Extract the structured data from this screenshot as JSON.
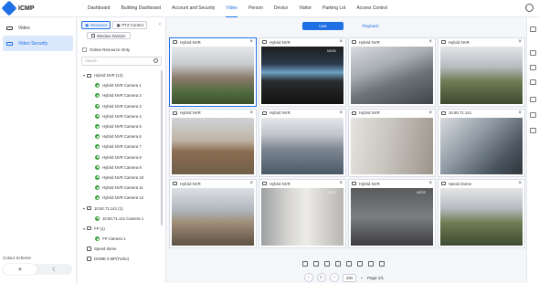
{
  "app": {
    "brand": "ICMP"
  },
  "menu": [
    "Dashboard",
    "Building Dashboard",
    "Account and Security",
    "Video",
    "Person",
    "Device",
    "Visitor",
    "Parking Lot",
    "Access Control"
  ],
  "menu_active": "Video",
  "leftnav": [
    {
      "label": "Video",
      "selected": false
    },
    {
      "label": "Video Security",
      "selected": true
    }
  ],
  "colour_scheme": {
    "label": "Colour Scheme",
    "options": [
      "☀",
      "☾"
    ],
    "active": 0
  },
  "resource": {
    "tabs": [
      {
        "label": "Resource",
        "on": true
      },
      {
        "label": "PTZ Control",
        "on": false
      }
    ],
    "window_division": "Window Division",
    "online_only": "Online Resource Only",
    "search_placeholder": "Search",
    "tree": [
      {
        "label": "Hybrid NVR (12)",
        "type": "nvr",
        "indent": 0,
        "arrow": "▾"
      },
      {
        "label": "Hybrid NVR Camera 1",
        "type": "cam",
        "indent": 1
      },
      {
        "label": "Hybrid NVR Camera 2",
        "type": "cam",
        "indent": 1
      },
      {
        "label": "Hybrid NVR Camera 3",
        "type": "cam",
        "indent": 1
      },
      {
        "label": "Hybrid NVR Camera 4",
        "type": "cam",
        "indent": 1
      },
      {
        "label": "Hybrid NVR Camera 5",
        "type": "cam",
        "indent": 1
      },
      {
        "label": "Hybrid NVR Camera 6",
        "type": "cam",
        "indent": 1
      },
      {
        "label": "Hybrid NVR Camera 7",
        "type": "cam",
        "indent": 1
      },
      {
        "label": "Hybrid NVR Camera 8",
        "type": "cam",
        "indent": 1
      },
      {
        "label": "Hybrid NVR Camera 9",
        "type": "cam",
        "indent": 1
      },
      {
        "label": "Hybrid NVR Camera 10",
        "type": "cam",
        "indent": 1
      },
      {
        "label": "Hybrid NVR Camera 11",
        "type": "cam",
        "indent": 1
      },
      {
        "label": "Hybrid NVR Camera 12",
        "type": "cam",
        "indent": 1
      },
      {
        "label": "10.50.71.141 (1)",
        "type": "nvr",
        "indent": 0,
        "arrow": "▾"
      },
      {
        "label": "10.50.71.141 Camera 1",
        "type": "cam",
        "indent": 1
      },
      {
        "label": "FP (1)",
        "type": "nvr",
        "indent": 0,
        "arrow": "▾"
      },
      {
        "label": "FP Camera 1",
        "type": "cam",
        "indent": 1
      },
      {
        "label": "Speed dome",
        "type": "dome",
        "indent": 0
      },
      {
        "label": "DOME 5 MP(Turbo)",
        "type": "dome",
        "indent": 0
      }
    ]
  },
  "view": {
    "live": "Live",
    "playback": "Playback"
  },
  "tiles": [
    {
      "title": "Hybrid NVR",
      "scene": "v-sky",
      "msse": "",
      "sel": true
    },
    {
      "title": "Hybrid NVR",
      "scene": "v-dark",
      "msse": "MSSE",
      "sel": false
    },
    {
      "title": "Hybrid NVR",
      "scene": "v-street",
      "msse": "",
      "sel": false
    },
    {
      "title": "Hybrid NVR",
      "scene": "v-trees",
      "msse": "",
      "sel": false
    },
    {
      "title": "Hybrid NVR",
      "scene": "v-roof",
      "msse": "",
      "sel": false
    },
    {
      "title": "Hybrid NVR",
      "scene": "v-river",
      "msse": "",
      "sel": false
    },
    {
      "title": "Hybrid NVR",
      "scene": "v-light",
      "msse": "",
      "sel": false
    },
    {
      "title": "10.50.71.141",
      "scene": "v-office",
      "msse": "",
      "sel": false
    },
    {
      "title": "Hybrid NVR",
      "scene": "v-hill",
      "msse": "",
      "sel": false
    },
    {
      "title": "Hybrid NVR",
      "scene": "v-wall",
      "msse": "MSSE",
      "sel": false
    },
    {
      "title": "Hybrid NVR",
      "scene": "v-grey",
      "msse": "MSSE",
      "sel": false
    },
    {
      "title": "Speed Dome",
      "scene": "v-trees",
      "msse": "",
      "sel": false
    }
  ],
  "pager": {
    "zoom": "20s",
    "page": "Page 1/1"
  }
}
